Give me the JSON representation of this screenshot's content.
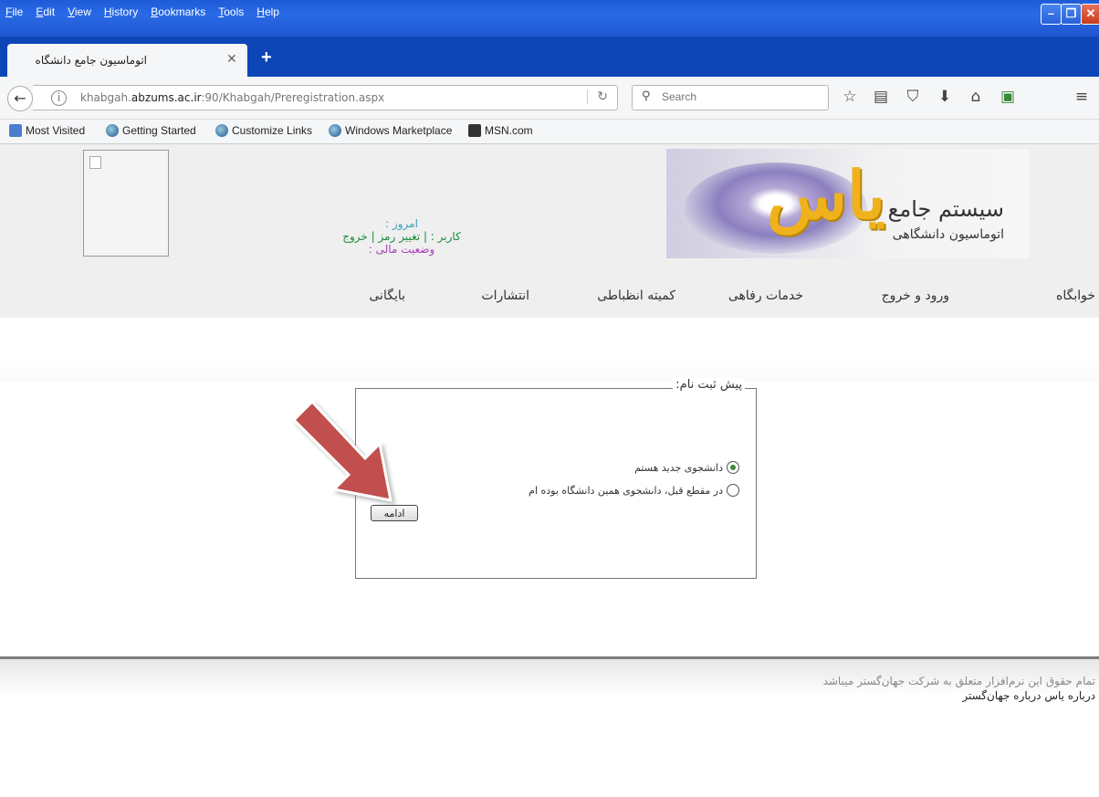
{
  "browser": {
    "menu": [
      "File",
      "Edit",
      "View",
      "History",
      "Bookmarks",
      "Tools",
      "Help"
    ],
    "tab_title": "اتوماسیون جامع دانشگاه",
    "url_prefix": "khabgah.",
    "url_domain": "abzums.ac.ir",
    "url_suffix": ":90/Khabgah/Preregistration.aspx",
    "search_placeholder": "Search",
    "bookmarks": [
      "Most Visited",
      "Getting Started",
      "Customize Links",
      "Windows Marketplace",
      "MSN.com"
    ]
  },
  "header": {
    "date_label": "امروز :",
    "user_label": "کاربر :",
    "change_password": "تغییر رمز",
    "logout": "خروج",
    "financial_status": "وضعیت مالی :",
    "banner_title": "سیستم جامع",
    "banner_subtitle": "اتوماسیون دانشگاهی",
    "banner_logo_text": "یاس"
  },
  "nav": [
    "خوابگاه",
    "ورود و خروج",
    "خدمات رفاهی",
    "کمیته انظباطی",
    "انتشارات",
    "بایگانی"
  ],
  "form": {
    "legend": "پیش ثبت نام:",
    "options": [
      {
        "label": "دانشجوی جدید هستم",
        "checked": true
      },
      {
        "label": "در مقطع قبل، دانشجوی همین دانشگاه بوده ام",
        "checked": false
      }
    ],
    "continue_label": "ادامه"
  },
  "footer": {
    "copyright": "تمام حقوق این نرم‌افزار متعلق به شرکت جهان‌گستر میباشد",
    "about": "درباره یاس درباره جهان‌گستر"
  },
  "colors": {
    "arrow": "#c0504d",
    "menubar": "#2a6ae6"
  }
}
